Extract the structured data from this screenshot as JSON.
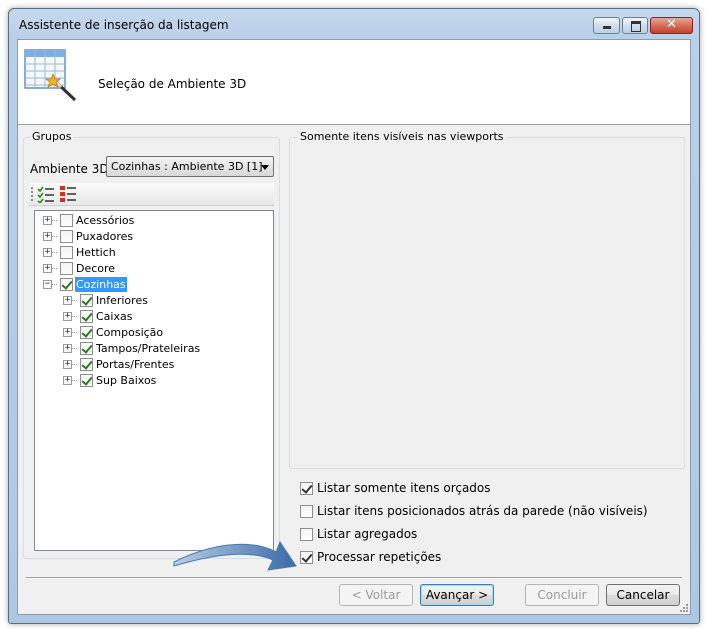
{
  "window": {
    "title": "Assistente de inserção da listagem"
  },
  "header": {
    "subtitle": "Seleção de Ambiente 3D"
  },
  "groups": {
    "title": "Grupos",
    "ambiente_label": "Ambiente 3D:",
    "ambiente_value": "Cozinhas : Ambiente 3D [1]",
    "tree": [
      {
        "label": "Acessórios",
        "checked": false,
        "expanded": false
      },
      {
        "label": "Puxadores",
        "checked": false,
        "expanded": false
      },
      {
        "label": "Hettich",
        "checked": false,
        "expanded": false
      },
      {
        "label": "Decore",
        "checked": false,
        "expanded": false
      },
      {
        "label": "Cozinhas",
        "checked": true,
        "expanded": true,
        "selected": true,
        "children": [
          {
            "label": "Inferiores",
            "checked": true
          },
          {
            "label": "Caixas",
            "checked": true
          },
          {
            "label": "Composição",
            "checked": true
          },
          {
            "label": "Tampos/Prateleiras",
            "checked": true
          },
          {
            "label": "Portas/Frentes",
            "checked": true
          },
          {
            "label": "Sup Baixos",
            "checked": true
          }
        ]
      }
    ]
  },
  "viewports": {
    "title": "Somente itens visíveis nas viewports"
  },
  "options": [
    {
      "label": "Listar somente itens orçados",
      "checked": true
    },
    {
      "label": "Listar itens posicionados atrás da parede (não visíveis)",
      "checked": false
    },
    {
      "label": "Listar agregados",
      "checked": false
    },
    {
      "label": "Processar repetições",
      "checked": true
    }
  ],
  "buttons": {
    "back": "< Voltar",
    "next": "Avançar >",
    "finish": "Concluir",
    "cancel": "Cancelar"
  },
  "colors": {
    "selection": "#3399ff",
    "check": "#2a7a20",
    "arrow": "#4a7ab0"
  }
}
